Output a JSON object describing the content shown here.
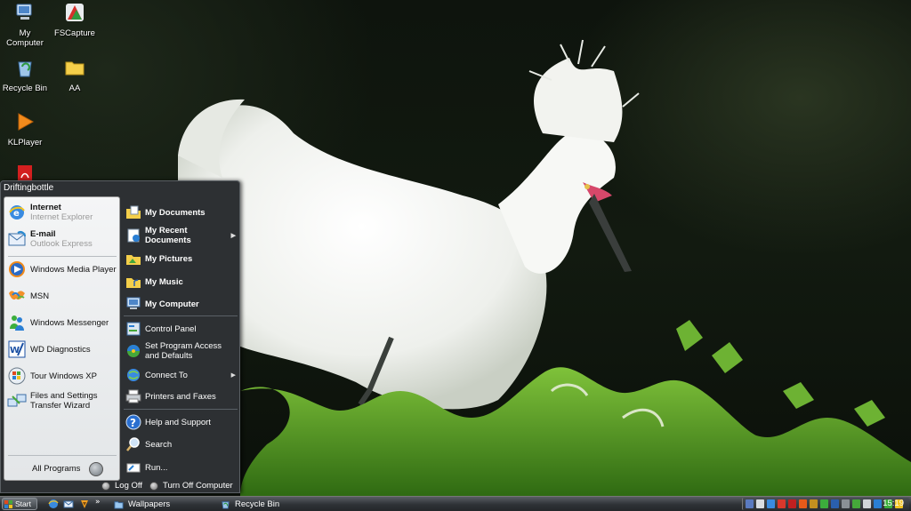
{
  "desktop": {
    "icons": [
      {
        "label": "My Computer",
        "icon": "computer-icon"
      },
      {
        "label": "FSCapture",
        "icon": "fscapture-icon"
      },
      {
        "label": "Recycle Bin",
        "icon": "recycle-bin-icon"
      },
      {
        "label": "AA",
        "icon": "folder-icon"
      },
      {
        "label": "KLPlayer",
        "icon": "klplayer-icon"
      },
      {
        "label": "",
        "icon": "pdf-icon"
      }
    ]
  },
  "start_menu": {
    "user_name": "Driftingbottle",
    "pinned": [
      {
        "title": "Internet",
        "subtitle": "Internet Explorer",
        "icon": "internet-explorer-icon"
      },
      {
        "title": "E-mail",
        "subtitle": "Outlook Express",
        "icon": "outlook-express-icon"
      }
    ],
    "recent": [
      {
        "label": "Windows Media Player",
        "icon": "media-player-icon"
      },
      {
        "label": "MSN",
        "icon": "msn-icon"
      },
      {
        "label": "Windows Messenger",
        "icon": "messenger-icon"
      },
      {
        "label": "WD Diagnostics",
        "icon": "wd-diagnostics-icon"
      },
      {
        "label": "Tour Windows XP",
        "icon": "tour-icon"
      },
      {
        "label": "Files and Settings Transfer Wizard",
        "icon": "transfer-wizard-icon"
      }
    ],
    "all_programs": "All Programs",
    "places": [
      {
        "label": "My Documents",
        "icon": "documents-icon"
      },
      {
        "label": "My Recent Documents",
        "icon": "recent-documents-icon",
        "submenu": true
      },
      {
        "label": "My Pictures",
        "icon": "pictures-icon"
      },
      {
        "label": "My Music",
        "icon": "music-icon"
      },
      {
        "label": "My Computer",
        "icon": "computer-icon"
      }
    ],
    "system": [
      {
        "label": "Control Panel",
        "icon": "control-panel-icon"
      },
      {
        "label": "Set Program Access and Defaults",
        "icon": "program-access-icon"
      },
      {
        "label": "Connect To",
        "icon": "connect-to-icon",
        "submenu": true
      },
      {
        "label": "Printers and Faxes",
        "icon": "printer-icon"
      }
    ],
    "tools": [
      {
        "label": "Help and Support",
        "icon": "help-icon"
      },
      {
        "label": "Search",
        "icon": "search-icon"
      },
      {
        "label": "Run...",
        "icon": "run-icon"
      }
    ],
    "log_off": "Log Off",
    "turn_off": "Turn Off Computer"
  },
  "taskbar": {
    "start_label": "Start",
    "quick_launch": [
      "internet-explorer-icon",
      "outlook-express-icon",
      "winamp-icon"
    ],
    "overflow": "»",
    "tasks": [
      {
        "label": "Wallpapers",
        "icon": "folder-icon"
      },
      {
        "label": "Recycle Bin",
        "icon": "recycle-bin-icon"
      }
    ],
    "clock": "15:19"
  },
  "colors": {
    "menu_dark": "#2d3033",
    "menu_light": "#eef0f2",
    "taskbar": "#2e3236"
  }
}
